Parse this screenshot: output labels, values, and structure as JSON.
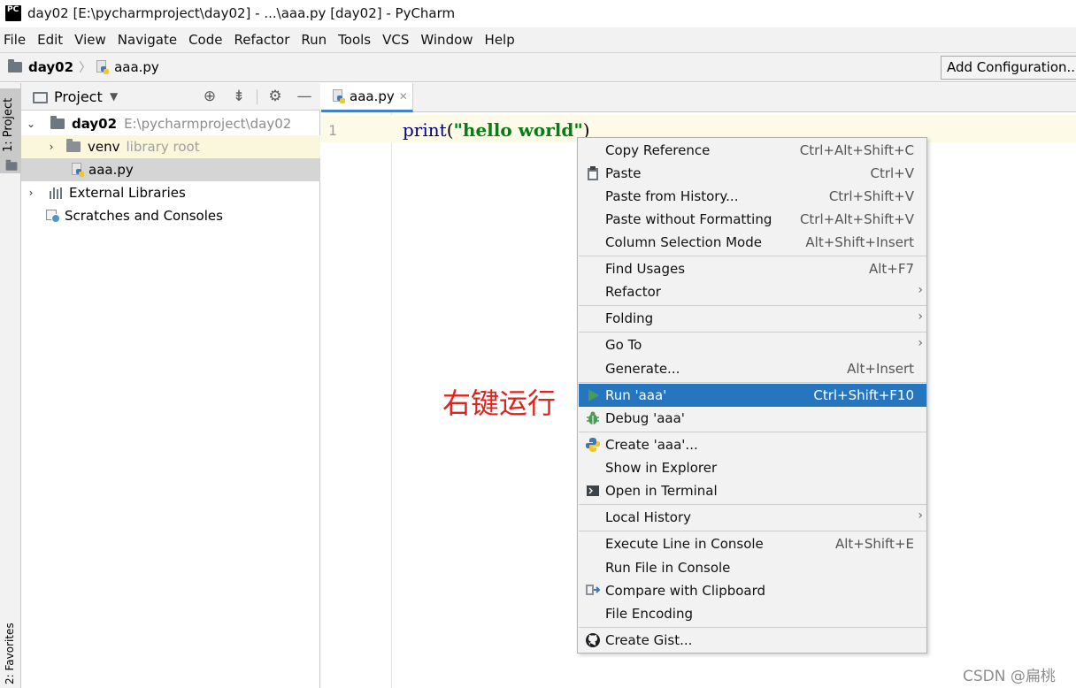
{
  "window": {
    "title": "day02 [E:\\pycharmproject\\day02] - ...\\aaa.py [day02] - PyCharm",
    "logo_text": "PC"
  },
  "menubar": {
    "items": [
      "File",
      "Edit",
      "View",
      "Navigate",
      "Code",
      "Refactor",
      "Run",
      "Tools",
      "VCS",
      "Window",
      "Help"
    ]
  },
  "navbar": {
    "project": "day02",
    "separator": "〉",
    "file": "aaa.py",
    "add_configuration": "Add Configuration..."
  },
  "left_strip": {
    "project_tab": "1: Project",
    "favorites_tab": "2: Favorites"
  },
  "project_panel": {
    "header": "Project",
    "tree": {
      "root_name": "day02",
      "root_path": "E:\\pycharmproject\\day02",
      "venv_name": "venv",
      "venv_hint": "library root",
      "file_name": "aaa.py",
      "external_libraries": "External Libraries",
      "scratches": "Scratches and Consoles"
    }
  },
  "editor": {
    "tab_label": "aaa.py",
    "line_number": "1",
    "code": {
      "fn": "print",
      "open": "(",
      "string": "\"hello world\"",
      "close": ")"
    }
  },
  "annotation": "右键运行",
  "context_menu": {
    "items": [
      {
        "label": "Copy Reference",
        "shortcut": "Ctrl+Alt+Shift+C"
      },
      {
        "label": "Paste",
        "shortcut": "Ctrl+V",
        "icon": "clipboard-icon"
      },
      {
        "label": "Paste from History...",
        "shortcut": "Ctrl+Shift+V"
      },
      {
        "label": "Paste without Formatting",
        "shortcut": "Ctrl+Alt+Shift+V"
      },
      {
        "label": "Column Selection Mode",
        "shortcut": "Alt+Shift+Insert"
      },
      {
        "label": "Find Usages",
        "shortcut": "Alt+F7"
      },
      {
        "label": "Refactor",
        "submenu": true
      },
      {
        "label": "Folding",
        "submenu": true
      },
      {
        "label": "Go To",
        "submenu": true
      },
      {
        "label": "Generate...",
        "shortcut": "Alt+Insert"
      },
      {
        "label": "Run 'aaa'",
        "shortcut": "Ctrl+Shift+F10",
        "icon": "run-icon",
        "selected": true
      },
      {
        "label": "Debug 'aaa'",
        "icon": "debug-icon"
      },
      {
        "label": "Create 'aaa'...",
        "icon": "python-icon"
      },
      {
        "label": "Show in Explorer"
      },
      {
        "label": "Open in Terminal",
        "icon": "terminal-icon"
      },
      {
        "label": "Local History",
        "submenu": true
      },
      {
        "label": "Execute Line in Console",
        "shortcut": "Alt+Shift+E"
      },
      {
        "label": "Run File in Console"
      },
      {
        "label": "Compare with Clipboard",
        "icon": "compare-icon"
      },
      {
        "label": "File Encoding"
      },
      {
        "label": "Create Gist...",
        "icon": "github-icon"
      }
    ],
    "selection_color": "#2675bf"
  },
  "watermark": "CSDN @扁桃",
  "colors": {
    "accent": "#4083c9",
    "annotation": "#e0231c",
    "string": "#067d17",
    "function": "#000080"
  }
}
